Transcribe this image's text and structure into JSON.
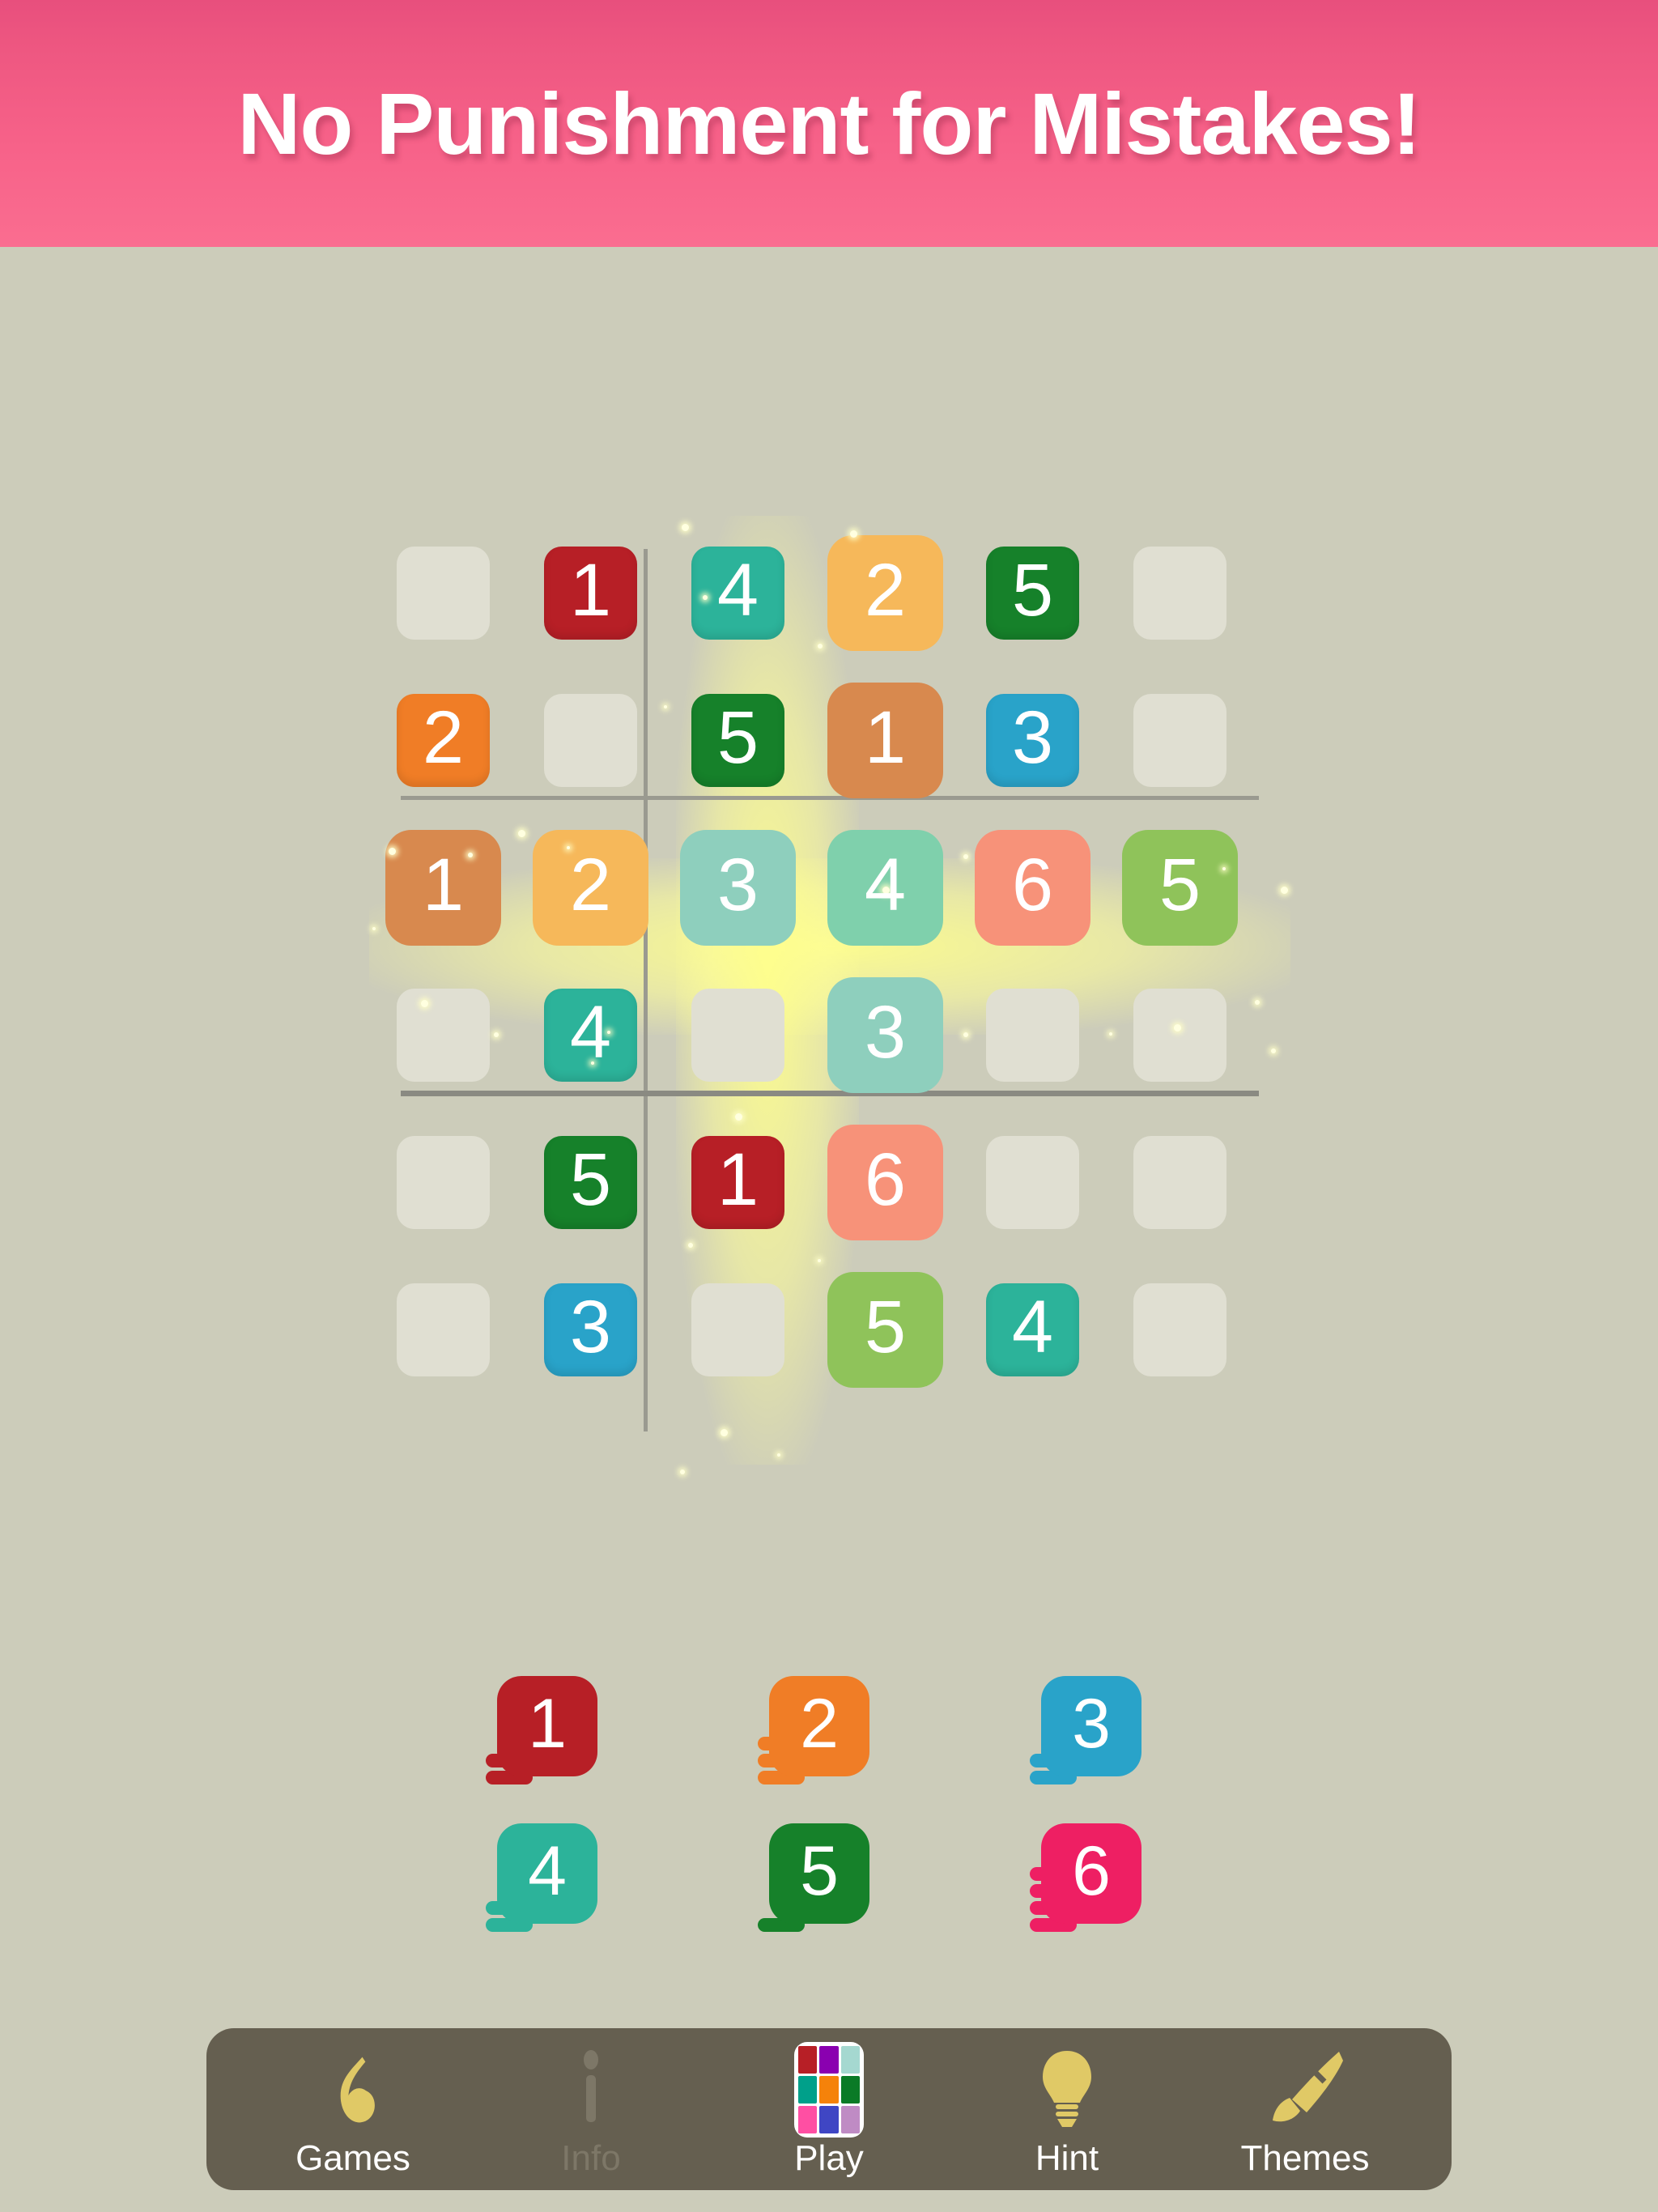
{
  "banner": {
    "title": "No Punishment for Mistakes!",
    "bg_top": "#e84f7d",
    "bg_bottom": "#fa6d90"
  },
  "board": {
    "size": 6,
    "highlight_row": 3,
    "highlight_col": 4,
    "empty_cell_color": "#e0dfd2",
    "background": "#ccccba",
    "number_colors": {
      "1": "#b71f26",
      "2": "#f07d26",
      "3": "#29a3c9",
      "4": "#2cb39a",
      "5": "#16812a",
      "6": "#ee1f63"
    },
    "halo_colors": {
      "1": "#d8894e",
      "2": "#f6b85a",
      "3": "#8ecfbd",
      "4": "#7fd0ac",
      "5": "#8fc35a",
      "6": "#f79279"
    },
    "rows": [
      [
        "",
        "1",
        "4",
        "2",
        "5",
        ""
      ],
      [
        "2",
        "",
        "5",
        "1",
        "3",
        ""
      ],
      [
        "1",
        "2",
        "3",
        "4",
        "6",
        "5"
      ],
      [
        "",
        "4",
        "",
        "3",
        "",
        ""
      ],
      [
        "",
        "5",
        "1",
        "6",
        "",
        ""
      ],
      [
        "",
        "3",
        "",
        "5",
        "4",
        ""
      ]
    ]
  },
  "tray": {
    "items": [
      {
        "value": "1",
        "remaining": 2,
        "color": "#b71f26"
      },
      {
        "value": "2",
        "remaining": 3,
        "color": "#f07d26"
      },
      {
        "value": "3",
        "remaining": 2,
        "color": "#29a3c9"
      },
      {
        "value": "4",
        "remaining": 2,
        "color": "#2cb39a"
      },
      {
        "value": "5",
        "remaining": 1,
        "color": "#16812a"
      },
      {
        "value": "6",
        "remaining": 4,
        "color": "#ee1f63"
      }
    ]
  },
  "navbar": {
    "background": "#655f50",
    "accent": "#e0c966",
    "items": [
      {
        "label": "Games",
        "icon": "music-note-icon",
        "disabled": false
      },
      {
        "label": "Info",
        "icon": "info-icon",
        "disabled": true
      },
      {
        "label": "Play",
        "icon": "color-grid-icon",
        "disabled": false
      },
      {
        "label": "Hint",
        "icon": "lightbulb-icon",
        "disabled": false
      },
      {
        "label": "Themes",
        "icon": "paintbrush-icon",
        "disabled": false
      }
    ],
    "play_icon_colors": [
      "#b71f26",
      "#8a00b0",
      "#a5d8d0",
      "#00a08a",
      "#f5820a",
      "#0a7a26",
      "#ff4fa3",
      "#3f46c4",
      "#bf8bc4"
    ]
  }
}
